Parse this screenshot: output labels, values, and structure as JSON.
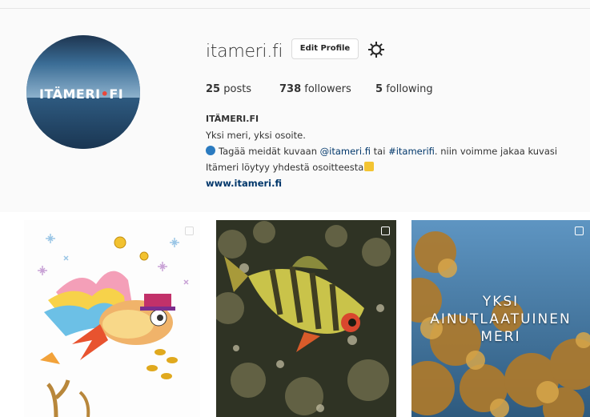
{
  "profile": {
    "username": "itameri.fi",
    "edit_profile_label": "Edit Profile",
    "avatar_logo_text_a": "ITÄMERI",
    "avatar_logo_text_b": "FI",
    "stats": {
      "posts_count": "25",
      "posts_label": "posts",
      "followers_count": "738",
      "followers_label": "followers",
      "following_count": "5",
      "following_label": "following"
    },
    "bio": {
      "name": "ITÄMERI.FI",
      "line1": "Yksi meri, yksi osoite.",
      "line2_prefix": "Tagää meidät kuvaan ",
      "line2_mention": "@itameri.fi",
      "line2_middle": " tai ",
      "line2_hashtag": "#itamerifi",
      "line2_suffix": ". niin voimme jakaa kuvasi",
      "line3": "Itämeri löytyy yhdestä osoitteesta",
      "website": "www.itameri.fi"
    }
  },
  "posts": [
    {
      "kind": "illustration",
      "overlay_text": []
    },
    {
      "kind": "photo",
      "overlay_text": []
    },
    {
      "kind": "photo",
      "overlay_text": [
        "YKSI",
        "AINUTLAATUINEN",
        "MERI"
      ]
    }
  ],
  "icons": {
    "settings": "gear-icon",
    "wave_emoji": "wave-icon",
    "pointing_emoji": "pointing-hand-icon",
    "multi_post": "carousel-icon"
  }
}
